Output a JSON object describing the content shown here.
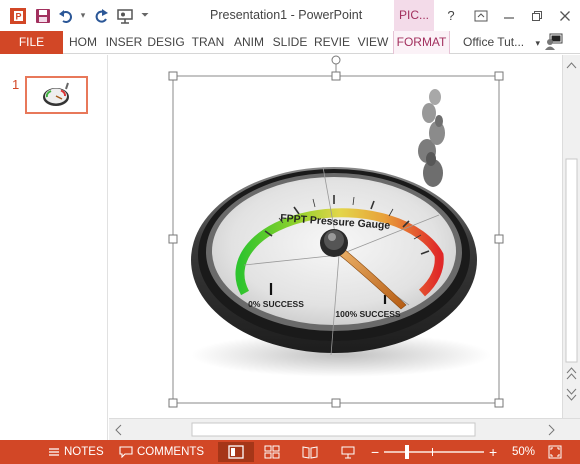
{
  "window": {
    "title": "Presentation1 - PowerPoint",
    "context_tab": "PIC...",
    "help": "?",
    "colors": {
      "accent": "#d24726",
      "context": "#a2305e",
      "context_bg": "#f3dbe9"
    }
  },
  "qat": {
    "icons": [
      "powerpoint-logo-icon",
      "save-icon",
      "undo-icon",
      "redo-icon",
      "present-icon",
      "customize-icon"
    ]
  },
  "ribbon": {
    "file_label": "FILE",
    "tabs": [
      "HOM",
      "INSER",
      "DESIG",
      "TRAN",
      "ANIM",
      "SLIDE",
      "REVIE",
      "VIEW",
      "FORMAT"
    ],
    "account": "Office Tut...",
    "account_caret": "▾"
  },
  "slides_panel": {
    "slide_number": "1"
  },
  "gauge": {
    "title": "FPPT Pressure Gauge",
    "left_label": "0% SUCCESS",
    "right_label": "100% SUCCESS"
  },
  "statusbar": {
    "notes_label": "NOTES",
    "comments_label": "COMMENTS",
    "zoom_minus": "−",
    "zoom_plus": "+",
    "zoom_level": "50%",
    "zoom_value": 50
  }
}
